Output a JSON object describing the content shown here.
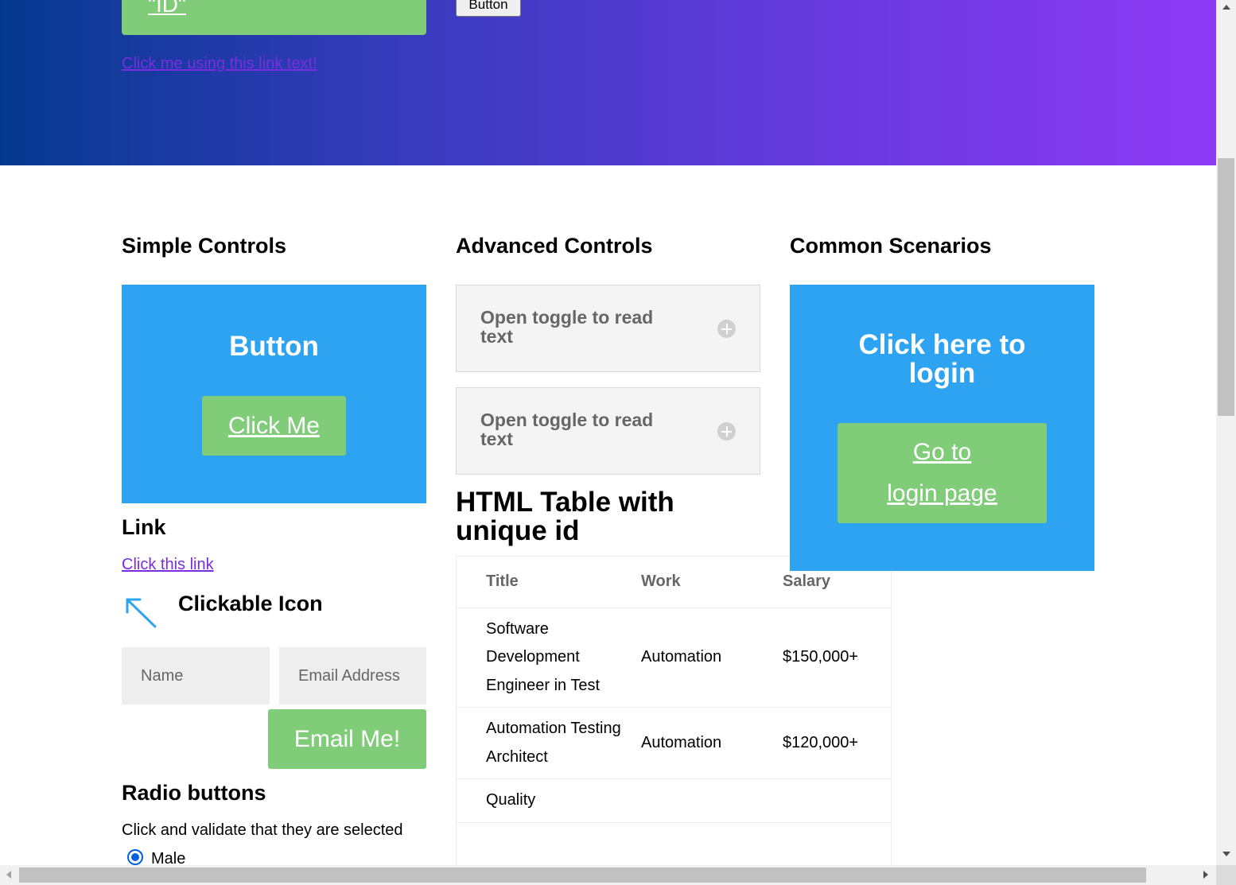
{
  "hero": {
    "id_button_label": "\"ID\"",
    "plain_button_label": "Button",
    "link_text": "Click me using this link text!"
  },
  "simple_controls": {
    "heading": "Simple Controls",
    "button_section_title": "Button",
    "click_me_label": "Click Me",
    "link_heading": "Link",
    "link_text": "Click this link",
    "clickable_icon_heading": "Clickable Icon",
    "name_placeholder": "Name",
    "email_placeholder": "Email Address",
    "email_button_label": "Email Me!",
    "radio_heading": "Radio buttons",
    "radio_description": "Click and validate that they are selected",
    "radio_option_male": "Male"
  },
  "advanced_controls": {
    "heading": "Advanced Controls",
    "toggles": [
      {
        "label": "Open toggle to read text"
      },
      {
        "label": "Open toggle to read text"
      }
    ],
    "table_heading": "HTML Table with unique id",
    "table": {
      "headers": [
        "Title",
        "Work",
        "Salary"
      ],
      "rows": [
        [
          "Software Development Engineer in Test",
          "Automation",
          "$150,000+"
        ],
        [
          "Automation Testing Architect",
          "Automation",
          "$120,000+"
        ],
        [
          "Quality",
          "",
          ""
        ]
      ]
    }
  },
  "common_scenarios": {
    "heading": "Common Scenarios",
    "login_title": "Click here to login",
    "login_button_label": "Go to login page"
  },
  "colors": {
    "accent_blue": "#2ea3f2",
    "button_green": "#80cc79",
    "link_purple": "#7a2de0"
  }
}
